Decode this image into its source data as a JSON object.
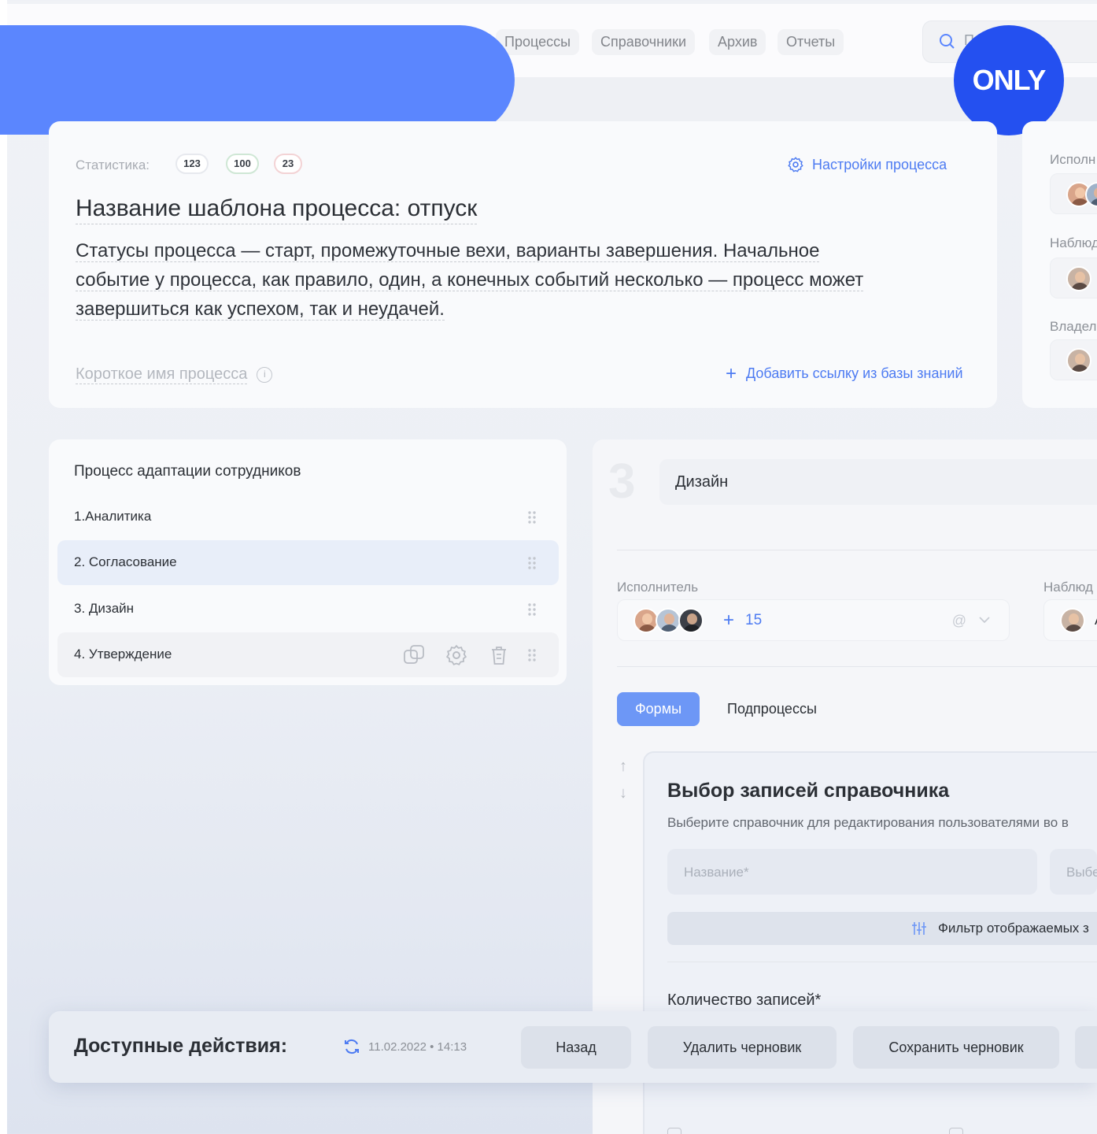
{
  "nav": {
    "items": [
      "Процессы",
      "Справочники",
      "Архив",
      "Отчеты"
    ],
    "search_placeholder": "П"
  },
  "badge": {
    "label": "ONLY"
  },
  "template": {
    "stats_label": "Статистика:",
    "stats": [
      "123",
      "100",
      "23"
    ],
    "settings_link": "Настройки процесса",
    "title": "Название шаблона процесса: отпуск",
    "description": [
      "Статусы процесса — старт, промежуточные вехи, варианты завершения. Начальное",
      "событие у процесса, как правило, один, а конечных событий несколько — процесс может",
      "завершиться как успехом, так и неудачей."
    ],
    "short_name_placeholder": "Короткое имя процесса",
    "kb_link": "Добавить ссылку из базы знаний"
  },
  "side": {
    "executor_label": "Исполн",
    "observer_label": "Наблюд",
    "owner_label": "Владел"
  },
  "steps": {
    "title": "Процесс адаптации сотрудников",
    "items": [
      "1.Аналитика",
      "2. Согласование",
      "3. Дизайн",
      "4. Утверждение"
    ]
  },
  "step_detail": {
    "number": "3",
    "name": "Дизайн",
    "executor_label": "Исполнитель",
    "executor_extra": "15",
    "observer_label": "Наблюд",
    "observer_initial": "А",
    "tabs": [
      "Формы",
      "Подпроцессы"
    ],
    "form": {
      "title": "Выбор записей справочника",
      "subtitle": "Выберите справочник для редактирования пользователями во в",
      "name_placeholder": "Название*",
      "select_placeholder": "Выбе",
      "filter_label": "Фильтр отображаемых з",
      "quantity_label": "Количество записей*"
    }
  },
  "actions": {
    "title": "Доступные действия:",
    "timestamp": "11.02.2022 • 14:13",
    "buttons": [
      "Назад",
      "Удалить черновик",
      "Сохранить черновик"
    ]
  },
  "colors": {
    "accent": "#4d7bf2",
    "banner": "#5b86fe",
    "badge": "#2450f0"
  }
}
